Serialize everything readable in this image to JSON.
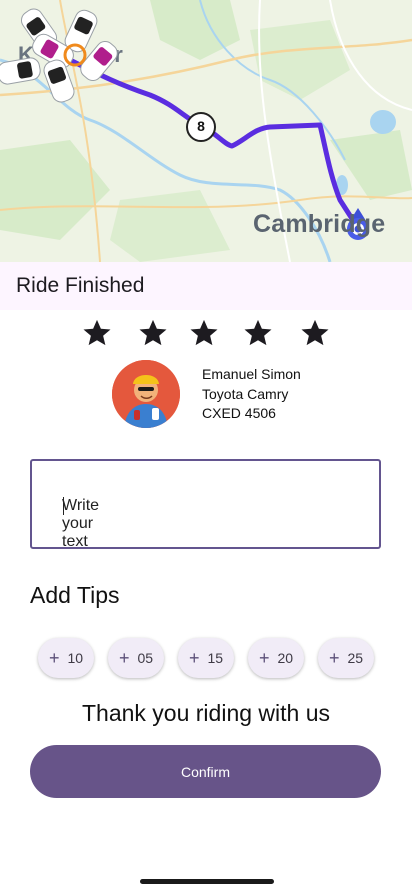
{
  "map": {
    "city_label": "Cambridge",
    "route_marker": "8",
    "route_color": "#5a2de0"
  },
  "title": "Ride Finished",
  "rating": {
    "max": 5,
    "value": 5
  },
  "driver": {
    "name": "Emanuel Simon",
    "car": "Toyota Camry",
    "plate": "CXED 4506"
  },
  "feedback": {
    "value": "Write your text"
  },
  "tips": {
    "heading": "Add Tips",
    "options": [
      {
        "plus": "+",
        "amount": "10"
      },
      {
        "plus": "+",
        "amount": "05"
      },
      {
        "plus": "+",
        "amount": "15"
      },
      {
        "plus": "+",
        "amount": "20"
      },
      {
        "plus": "+",
        "amount": "25"
      }
    ]
  },
  "thanks_text": "Thank you riding with us",
  "confirm_label": "Confirm",
  "colors": {
    "accent": "#675489",
    "title_bar": "#fdf5ff"
  }
}
